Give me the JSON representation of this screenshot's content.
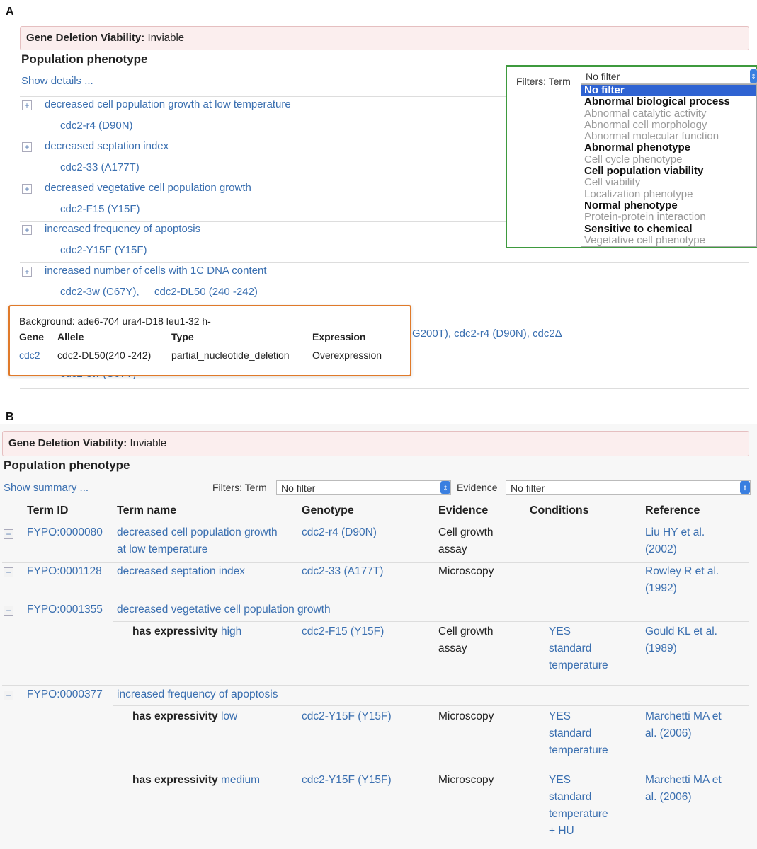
{
  "panel_a": {
    "label": "A",
    "viability_label": "Gene Deletion Viability:",
    "viability_value": "Inviable",
    "section_title": "Population phenotype",
    "show_details": "Show details ...",
    "filters_term_label": "Filters: Term",
    "filter_selected": "No filter",
    "filter_options": [
      {
        "label": "No filter",
        "style": "selected"
      },
      {
        "label": "Abnormal biological process",
        "style": "bold"
      },
      {
        "label": "Abnormal catalytic activity",
        "style": "grey"
      },
      {
        "label": "Abnormal cell morphology",
        "style": "grey"
      },
      {
        "label": "Abnormal molecular function",
        "style": "grey"
      },
      {
        "label": "Abnormal phenotype",
        "style": "bold"
      },
      {
        "label": "Cell cycle phenotype",
        "style": "grey"
      },
      {
        "label": "Cell population viability",
        "style": "bold"
      },
      {
        "label": "Cell viability",
        "style": "grey"
      },
      {
        "label": "Localization phenotype",
        "style": "grey"
      },
      {
        "label": "Normal phenotype",
        "style": "bold"
      },
      {
        "label": "Protein-protein interaction",
        "style": "grey"
      },
      {
        "label": "Sensitive to chemical",
        "style": "bold"
      },
      {
        "label": "Vegetative cell phenotype",
        "style": "grey"
      }
    ],
    "terms": [
      {
        "term": "decreased cell population growth at low temperature",
        "genotypes": "cdc2-r4 (D90N)"
      },
      {
        "term": "decreased septation index",
        "genotypes": "cdc2-33 (A177T)"
      },
      {
        "term": "decreased vegetative cell population growth",
        "genotypes": "cdc2-F15 (Y15F)"
      },
      {
        "term": "increased frequency of apoptosis",
        "genotypes": "cdc2-Y15F (Y15F)"
      },
      {
        "term": "increased number of cells with 1C DNA content",
        "genotypes_a": "cdc2-3w (C67Y),",
        "genotypes_b": "cdc2-DL50 (240 -242)"
      }
    ],
    "partial_row_genotypes": "G200T),   cdc2-r4 (D90N),   cdc2Δ",
    "tooltip": {
      "background": "Background: ade6-704 ura4-D18 leu1-32 h-",
      "headers": [
        "Gene",
        "Allele",
        "Type",
        "Expression"
      ],
      "row": [
        "cdc2",
        "cdc2-DL50(240 -242)",
        "partial_nucleotide_deletion",
        "Overexpression"
      ]
    }
  },
  "panel_b": {
    "label": "B",
    "viability_label": "Gene Deletion Viability:",
    "viability_value": "Inviable",
    "section_title": "Population phenotype",
    "show_summary": "Show summary ...",
    "filters_term_label": "Filters: Term",
    "term_filter_value": "No filter",
    "evidence_label": "Evidence",
    "evidence_filter_value": "No filter",
    "columns": [
      "Term ID",
      "Term name",
      "Genotype",
      "Evidence",
      "Conditions",
      "Reference"
    ],
    "rows": [
      {
        "id": "FYPO:0000080",
        "name_1": "decreased cell population growth",
        "name_2": "at low temperature",
        "genotype": "cdc2-r4 (D90N)",
        "evidence_1": "Cell growth",
        "evidence_2": "assay",
        "ref_1": "Liu HY et al.",
        "ref_2": "(2002)"
      },
      {
        "id": "FYPO:0001128",
        "name_1": "decreased septation index",
        "genotype": "cdc2-33 (A177T)",
        "evidence_1": "Microscopy",
        "ref_1": "Rowley R et al.",
        "ref_2": "(1992)"
      },
      {
        "id": "FYPO:0001355",
        "name_1": "decreased vegetative cell population growth"
      },
      {
        "id": "FYPO:0000377",
        "name_1": "increased frequency of apoptosis"
      }
    ],
    "sub_rows": [
      {
        "expr_label": "has expressivity",
        "expr_value": "high",
        "genotype": "cdc2-F15 (Y15F)",
        "evidence_1": "Cell growth",
        "evidence_2": "assay",
        "cond": [
          "YES",
          "standard",
          "temperature"
        ],
        "ref_1": "Gould KL et al.",
        "ref_2": "(1989)"
      },
      {
        "expr_label": "has expressivity",
        "expr_value": "low",
        "genotype": "cdc2-Y15F (Y15F)",
        "evidence_1": "Microscopy",
        "cond": [
          "YES",
          "standard",
          "temperature"
        ],
        "ref_1": "Marchetti MA et",
        "ref_2": "al. (2006)"
      },
      {
        "expr_label": "has expressivity",
        "expr_value": "medium",
        "genotype": "cdc2-Y15F (Y15F)",
        "evidence_1": "Microscopy",
        "cond": [
          "YES",
          "standard",
          "temperature",
          "+ HU"
        ],
        "ref_1": "Marchetti MA et",
        "ref_2": "al. (2006)"
      }
    ]
  }
}
